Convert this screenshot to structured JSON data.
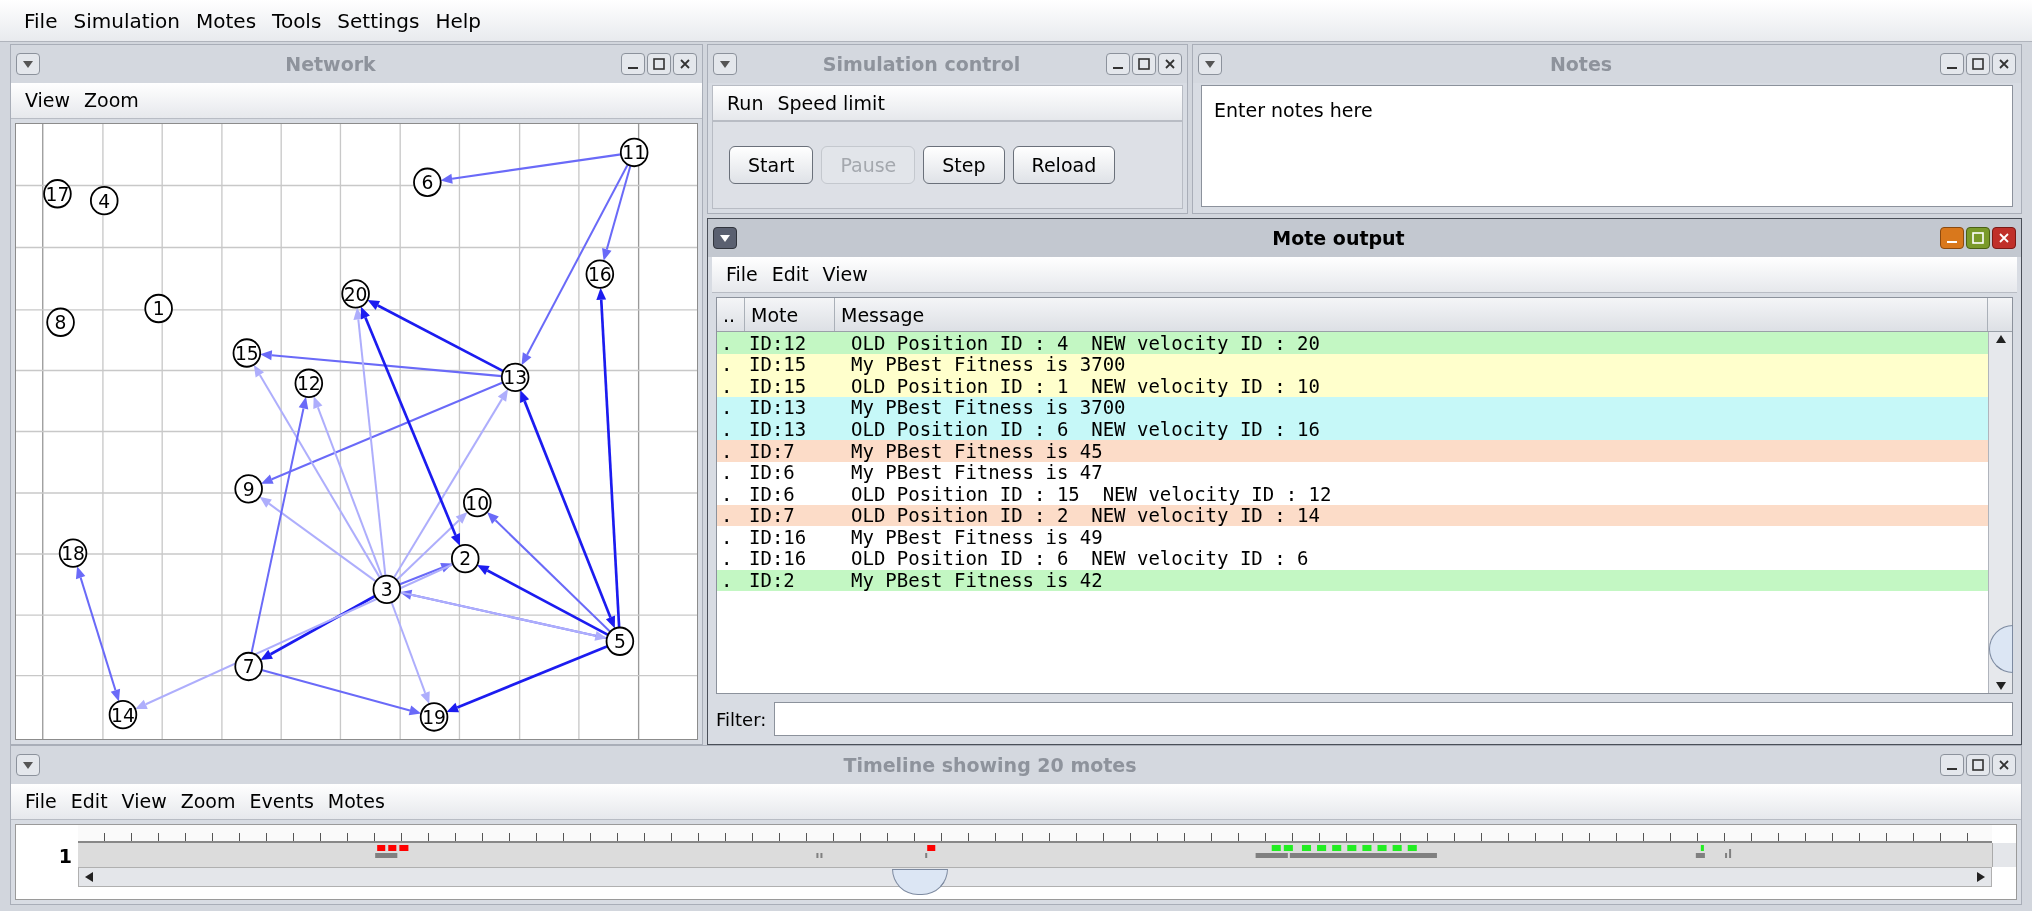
{
  "menu_bar": [
    "File",
    "Simulation",
    "Motes",
    "Tools",
    "Settings",
    "Help"
  ],
  "network": {
    "title": "Network",
    "active": false,
    "menu": [
      "View",
      "Zoom"
    ],
    "nodes": [
      "11",
      "6",
      "17",
      "4",
      "16",
      "20",
      "1",
      "8",
      "15",
      "13",
      "12",
      "9",
      "10",
      "18",
      "2",
      "3",
      "5",
      "7",
      "14",
      "19"
    ]
  },
  "simulation_control": {
    "title": "Simulation control",
    "active": false,
    "menu": [
      "Run",
      "Speed limit"
    ],
    "buttons": [
      {
        "label": "Start",
        "disabled": false
      },
      {
        "label": "Pause",
        "disabled": true
      },
      {
        "label": "Step",
        "disabled": false
      },
      {
        "label": "Reload",
        "disabled": false
      }
    ]
  },
  "notes": {
    "title": "Notes",
    "active": false,
    "text": "Enter notes here"
  },
  "mote_output": {
    "title": "Mote output",
    "active": true,
    "menu": [
      "File",
      "Edit",
      "View"
    ],
    "columns": [
      "..",
      "Mote",
      "Message"
    ],
    "rows": [
      {
        "col_1": ".",
        "mote": "ID:12",
        "message": "OLD Position ID : 4  NEW velocity ID : 20",
        "color": "#c3f7c3"
      },
      {
        "col_1": ".",
        "mote": "ID:15",
        "message": "My PBest Fitness is 3700",
        "color": "#ffffcc"
      },
      {
        "col_1": ".",
        "mote": "ID:15",
        "message": "OLD Position ID : 1  NEW velocity ID : 10",
        "color": "#ffffcc"
      },
      {
        "col_1": ".",
        "mote": "ID:13",
        "message": "My PBest Fitness is 3700",
        "color": "#c6f8f8"
      },
      {
        "col_1": ".",
        "mote": "ID:13",
        "message": "OLD Position ID : 6  NEW velocity ID : 16",
        "color": "#c6f8f8"
      },
      {
        "col_1": ".",
        "mote": "ID:7",
        "message": "My PBest Fitness is 45",
        "color": "#fcdcc8"
      },
      {
        "col_1": ".",
        "mote": "ID:6",
        "message": "My PBest Fitness is 47",
        "color": "#ffffff"
      },
      {
        "col_1": ".",
        "mote": "ID:6",
        "message": "OLD Position ID : 15  NEW velocity ID : 12",
        "color": "#ffffff"
      },
      {
        "col_1": ".",
        "mote": "ID:7",
        "message": "OLD Position ID : 2  NEW velocity ID : 14",
        "color": "#fcdcc8"
      },
      {
        "col_1": ".",
        "mote": "ID:16",
        "message": "My PBest Fitness is 49",
        "color": "#ffffff"
      },
      {
        "col_1": ".",
        "mote": "ID:16",
        "message": "OLD Position ID : 6  NEW velocity ID : 6",
        "color": "#ffffff"
      },
      {
        "col_1": ".",
        "mote": "ID:2",
        "message": "My PBest Fitness is 42",
        "color": "#c3f7c3"
      }
    ],
    "filter": {
      "label": "Filter:"
    }
  },
  "timeline": {
    "title": "Timeline showing 20 motes",
    "active": false,
    "menu": [
      "File",
      "Edit",
      "View",
      "Zoom",
      "Events",
      "Motes"
    ],
    "rows": [
      "1"
    ]
  }
}
